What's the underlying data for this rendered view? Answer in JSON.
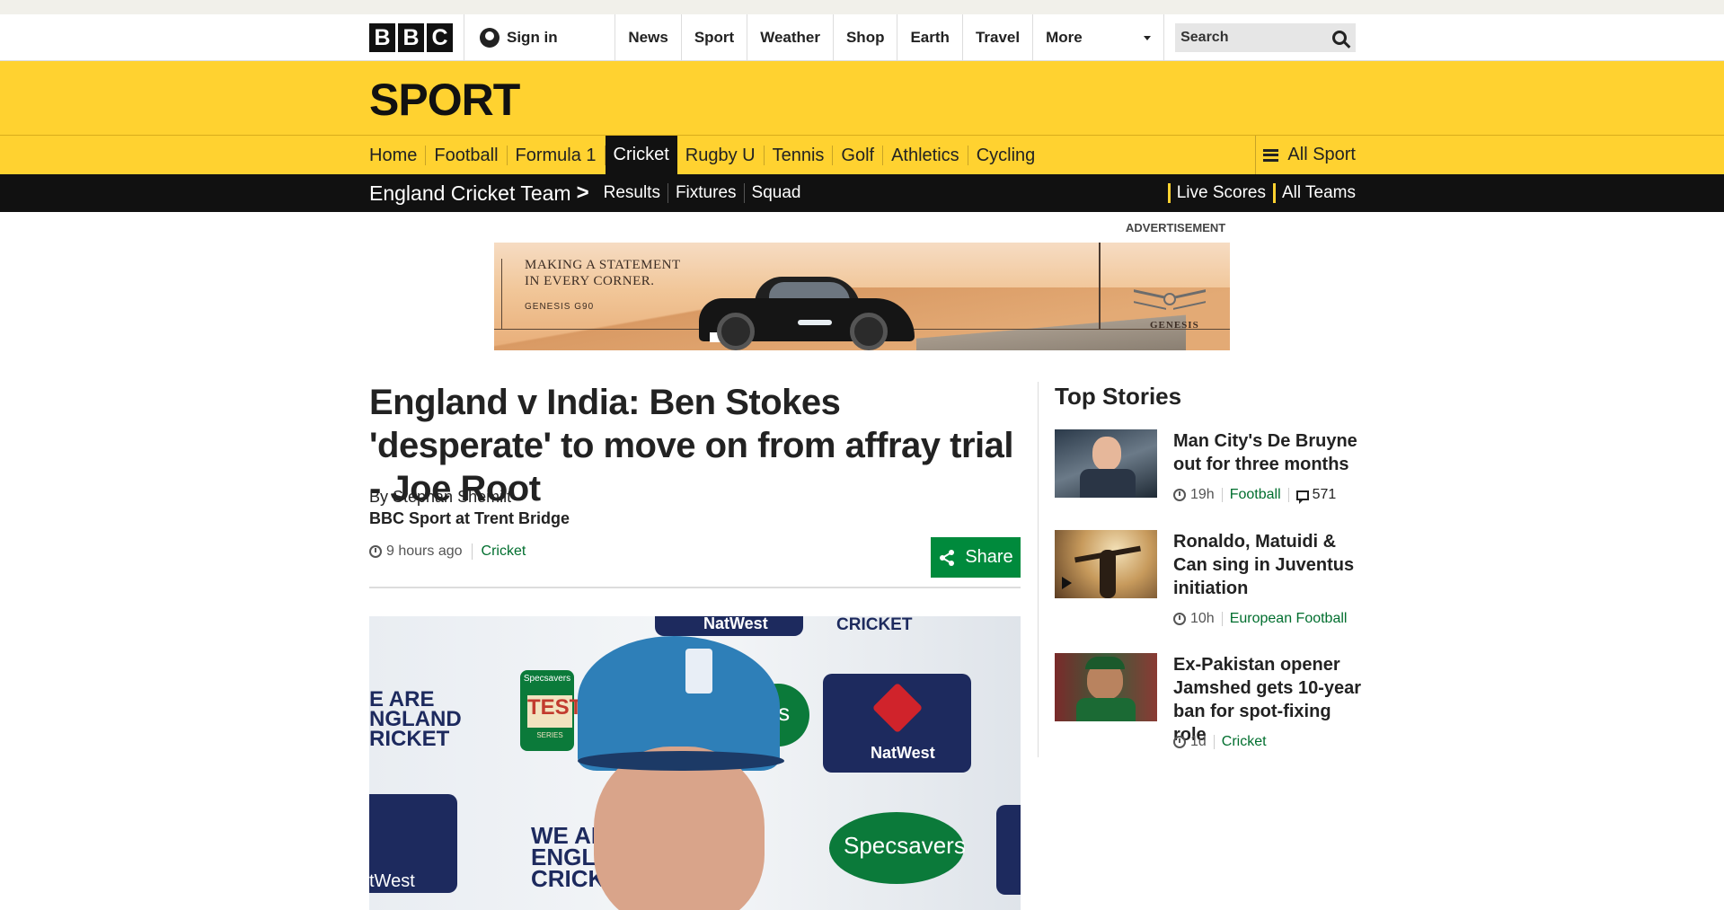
{
  "header": {
    "logo_letters": [
      "B",
      "B",
      "C"
    ],
    "signin_label": "Sign in",
    "nav": [
      "News",
      "Sport",
      "Weather",
      "Shop",
      "Earth",
      "Travel"
    ],
    "more_label": "More",
    "search_placeholder": "Search"
  },
  "sport": {
    "title": "SPORT",
    "nav": [
      "Home",
      "Football",
      "Formula 1",
      "Cricket",
      "Rugby U",
      "Tennis",
      "Golf",
      "Athletics",
      "Cycling"
    ],
    "active_nav": "Cricket",
    "all_sport_label": "All Sport",
    "accent": "#ffd230"
  },
  "team_nav": {
    "title": "England Cricket Team",
    "links": [
      "Results",
      "Fixtures",
      "Squad"
    ],
    "right_links": [
      "Live Scores",
      "All Teams"
    ]
  },
  "ad": {
    "label": "ADVERTISEMENT",
    "copy_line1": "MAKING A STATEMENT",
    "copy_line2": "IN EVERY CORNER.",
    "model": "GENESIS G90",
    "brand": "GENESIS"
  },
  "article": {
    "headline": "England v India: Ben Stokes 'desperate' to move on from affray trial - Joe Root",
    "author": "By Stephan Shemilt",
    "org": "BBC Sport at Trent Bridge",
    "time": "9 hours ago",
    "section": "Cricket",
    "share_label": "Share",
    "hero_texts": {
      "natwest_top": "NatWest",
      "cricket_top": "CRICKET",
      "we_are_left": "E ARE",
      "ngland_left": "NGLAND",
      "ricket_left": "RICKET",
      "specsavers_small": "Specsavers",
      "test": "TEST",
      "series": "SERIES",
      "ers": "ers",
      "natwest_mid": "NatWest",
      "we_are": "WE ARE",
      "england": "ENGLAND",
      "cricket": "CRICKET",
      "specsavers": "Specsavers",
      "west": "tWest"
    }
  },
  "sidebar": {
    "heading": "Top Stories",
    "stories": [
      {
        "title": "Man City's De Bruyne out for three months",
        "time": "19h",
        "section": "Football",
        "comments": "571"
      },
      {
        "title": "Ronaldo, Matuidi & Can sing in Juventus initiation",
        "time": "10h",
        "section": "European Football"
      },
      {
        "title": "Ex-Pakistan opener Jamshed gets 10-year ban for spot-fixing role",
        "time": "1d",
        "section": "Cricket"
      }
    ]
  }
}
